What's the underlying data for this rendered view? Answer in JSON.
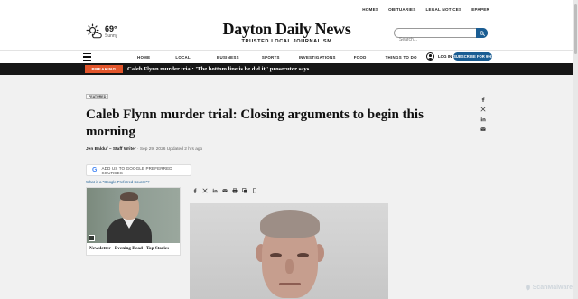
{
  "utility": {
    "links": [
      "HOMES",
      "OBITUARIES",
      "LEGAL NOTICES",
      "EPAPER"
    ]
  },
  "weather": {
    "temp": "69°",
    "condition": "Sunny",
    "icon": "sun-cloud-icon"
  },
  "masthead": {
    "name": "Dayton Daily News",
    "tagline": "TRUSTED LOCAL JOURNALISM"
  },
  "search": {
    "placeholder": "Search...",
    "icon": "search-icon"
  },
  "nav": {
    "items": [
      "HOME",
      "LOCAL",
      "BUSINESS",
      "SPORTS",
      "INVESTIGATIONS",
      "FOOD",
      "THINGS TO DO"
    ],
    "login": "LOG IN",
    "subscribe": "SUBSCRIBE FOR 99¢"
  },
  "breaking": {
    "label": "BREAKING",
    "headline": "Caleb Flynn murder trial: 'The bottom line is he did it,' prosecutor says"
  },
  "article": {
    "badge": "FEATURED",
    "title": "Caleb Flynn murder trial: Closing arguments to begin this morning",
    "author": "Jen Balduf – Staff Writer",
    "date": " · Sep 29, 2026 Updated 2 hrs ago",
    "google_button": "ADD US TO GOOGLE PREFERRED SOURCES",
    "google_link": "What is a \"Google Preferred Source\"?"
  },
  "video": {
    "caption": "Newsletter - Evening Read - Top Stories"
  },
  "watermark": "ScanMalware",
  "colors": {
    "brand_blue": "#1a5d93",
    "breaking_orange": "#e2552b",
    "bar_dark": "#161616"
  }
}
